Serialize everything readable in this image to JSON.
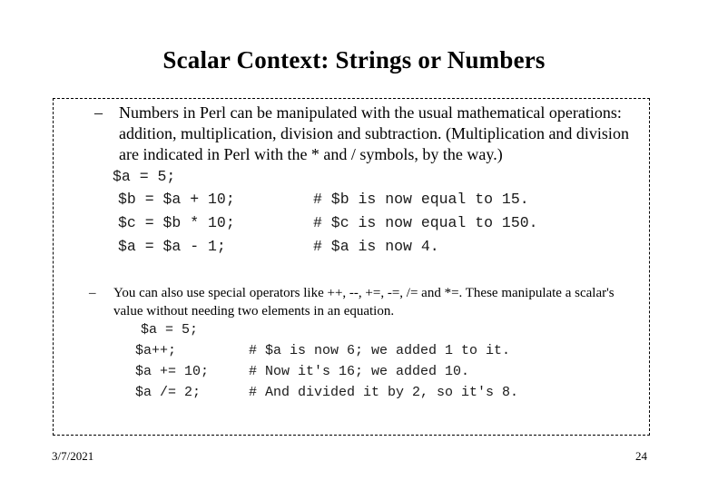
{
  "slide": {
    "title": "Scalar Context: Strings or Numbers",
    "bullets": [
      {
        "marker": "–",
        "text": "Numbers in Perl can be manipulated with the usual mathematical operations: addition, multiplication, division and subtraction. (Multiplication and division are indicated in Perl with the * and / symbols, by the way.)",
        "code": [
          {
            "statement": "$a = 5;",
            "comment": ""
          },
          {
            "statement": "$b = $a + 10;",
            "comment": "# $b is now equal to 15."
          },
          {
            "statement": "$c = $b * 10;",
            "comment": "# $c is now equal to 150."
          },
          {
            "statement": "$a = $a - 1;",
            "comment": "# $a is now 4."
          }
        ]
      },
      {
        "marker": "–",
        "text": "You can also use special operators like ++, --, +=, -=, /= and *=. These manipulate a scalar's value without needing two elements in an  equation.",
        "code": [
          {
            "statement": "$a = 5;",
            "comment": ""
          },
          {
            "statement": "$a++;",
            "comment": "# $a is now 6; we added 1 to it."
          },
          {
            "statement": "$a += 10;",
            "comment": "# Now it's 16; we added 10."
          },
          {
            "statement": "$a /= 2;",
            "comment": "# And divided it by 2, so it's 8."
          }
        ]
      }
    ],
    "footer": {
      "date": "3/7/2021",
      "page_number": "24"
    }
  }
}
